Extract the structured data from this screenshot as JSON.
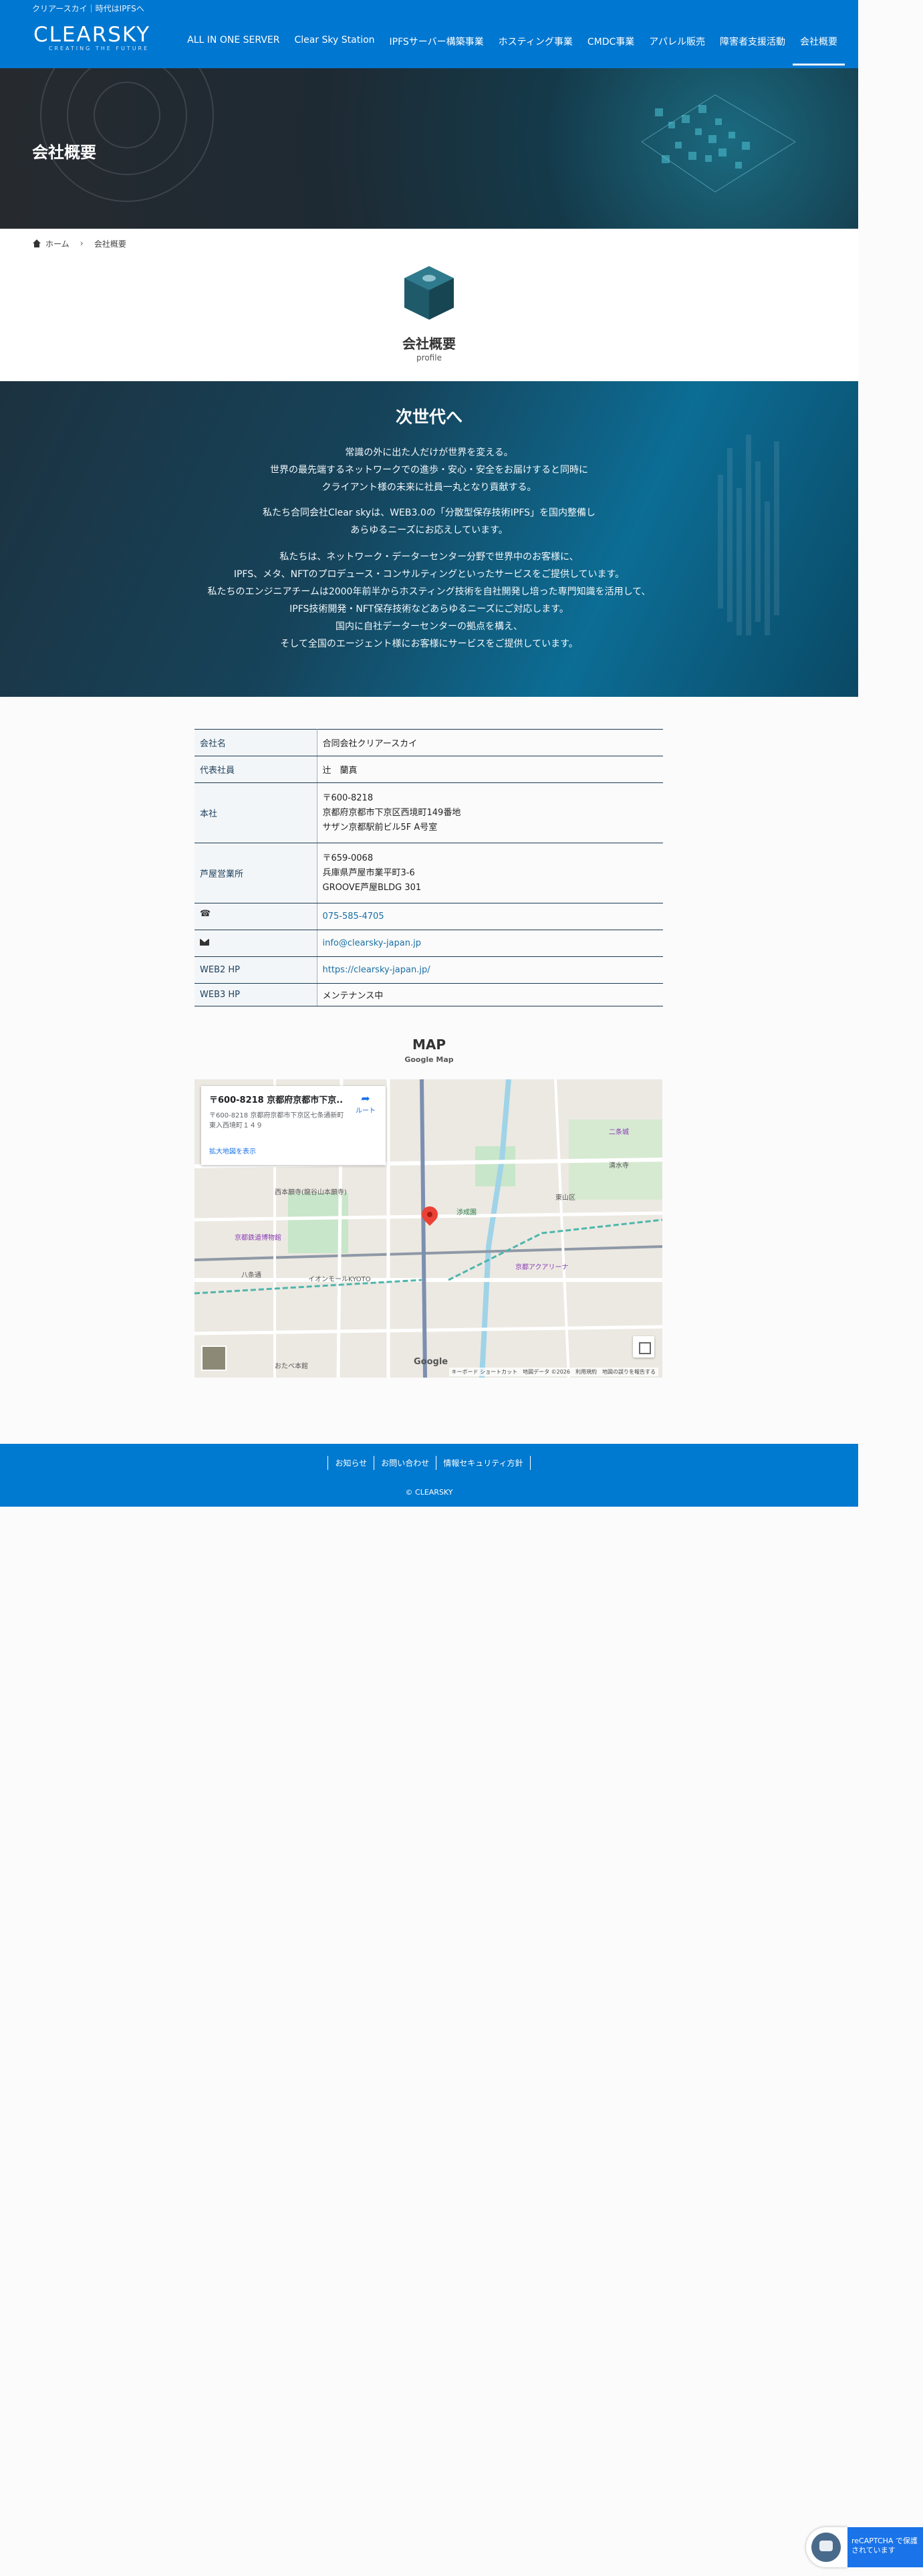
{
  "header": {
    "tagline": "クリアースカイ｜時代はIPFSへ",
    "logo_text": "CLEARSKY",
    "logo_sub": "CREATING THE FUTURE",
    "nav": [
      "ALL IN ONE SERVER",
      "Clear Sky Station",
      "IPFSサーバー構築事業",
      "ホスティング事業",
      "CMDC事業",
      "アパレル販売",
      "障害者支援活動",
      "会社概要"
    ],
    "active_nav": "会社概要"
  },
  "hero": {
    "title": "会社概要"
  },
  "breadcrumb": {
    "home": "ホーム",
    "current": "会社概要"
  },
  "profile": {
    "title": "会社概要",
    "subtitle": "profile"
  },
  "nextgen": {
    "title": "次世代へ",
    "paragraph1": [
      "常識の外に出た人だけが世界を変える。",
      "世界の最先端するネットワークでの進歩・安心・安全をお届けすると同時に",
      "クライアント様の未来に社員一丸となり貢献する。"
    ],
    "paragraph2": [
      "私たち合同会社Clear skyは、WEB3.0の「分散型保存技術IPFS」を国内整備し",
      "あらゆるニーズにお応えしています。"
    ],
    "paragraph3": [
      "私たちは、ネットワーク・データーセンター分野で世界中のお客様に、",
      "IPFS、メタ、NFTのプロデュース・コンサルティングといったサービスをご提供しています。",
      "私たちのエンジニアチームは2000年前半からホスティング技術を自社開発し培った専門知識を活用して、",
      "IPFS技術開発・NFT保存技術などあらゆるニーズにご対応します。",
      "国内に自社データーセンターの拠点を構え、",
      "そして全国のエージェント様にお客様にサービスをご提供しています。"
    ]
  },
  "company": {
    "name_label": "会社名",
    "name": "合同会社クリアースカイ",
    "rep_label": "代表社員",
    "rep": "辻　蘭真",
    "hq_label": "本社",
    "hq": [
      "〒600-8218",
      "京都府京都市下京区西境町149番地",
      "サザン京都駅前ビル5F A号室"
    ],
    "ashiya_label": "芦屋営業所",
    "ashiya": [
      "〒659-0068",
      "兵庫県芦屋市業平町3-6",
      "GROOVE芦屋BLDG 301"
    ],
    "phone": "075-585-4705",
    "email": "info@clearsky-japan.jp",
    "web2_label": "WEB2 HP",
    "web2": "https://clearsky-japan.jp/",
    "web3_label": "WEB3 HP",
    "web3": "メンテナンス中"
  },
  "map": {
    "title": "MAP",
    "subtitle": "Google Map",
    "card_title": "〒600-8218 京都府京都市下京...",
    "card_address": "〒600-8218 京都府京都市下京区七条通新町東入西境町１４９",
    "route_label": "ルート",
    "enlarge_label": "拡大地図を表示",
    "google_logo": "Google",
    "attribution": "キーボード ショートカット　地図データ ©2026　利用規約　地図の誤りを報告する",
    "labels": [
      "京都鉄道博物館",
      "イオンモールKYOTO",
      "おたべ本館",
      "二条城",
      "西本願寺(龍谷山本願寺)",
      "清水寺",
      "東山区",
      "京都アクアリーナ",
      "渉成園",
      "八条通"
    ]
  },
  "footer": {
    "links": [
      "お知らせ",
      "お問い合わせ",
      "情報セキュリティ方針"
    ],
    "copyright": "© CLEARSKY"
  },
  "recaptcha": {
    "text": "reCAPTCHA で保護されています"
  }
}
